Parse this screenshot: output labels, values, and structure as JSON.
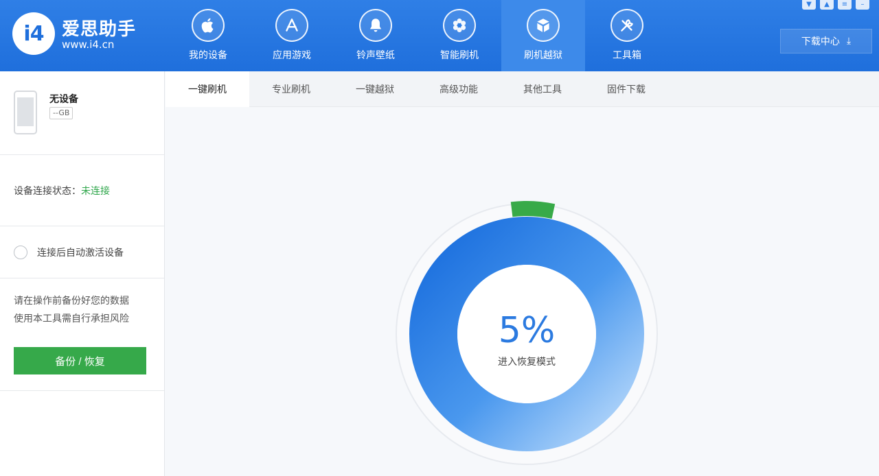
{
  "app": {
    "brand_name": "爱思助手",
    "brand_url": "www.i4.cn",
    "logo_text": "i4"
  },
  "nav": [
    {
      "label": "我的设备",
      "icon": "apple-icon"
    },
    {
      "label": "应用游戏",
      "icon": "app-store-icon"
    },
    {
      "label": "铃声壁纸",
      "icon": "bell-icon"
    },
    {
      "label": "智能刷机",
      "icon": "flower-icon"
    },
    {
      "label": "刷机越狱",
      "icon": "box-icon",
      "active": true
    },
    {
      "label": "工具箱",
      "icon": "tools-icon"
    }
  ],
  "download_center": {
    "label": "下载中心"
  },
  "sidebar": {
    "device_name": "无设备",
    "device_storage": "--GB",
    "connection_label": "设备连接状态：",
    "connection_status": "未连接",
    "auto_activate_label": "连接后自动激活设备",
    "notice_line1": "请在操作前备份好您的数据",
    "notice_line2": "使用本工具需自行承担风险",
    "backup_button": "备份 / 恢复"
  },
  "tabs": [
    {
      "label": "一键刷机",
      "active": true
    },
    {
      "label": "专业刷机"
    },
    {
      "label": "一键越狱"
    },
    {
      "label": "高级功能"
    },
    {
      "label": "其他工具"
    },
    {
      "label": "固件下载"
    }
  ],
  "progress": {
    "percent_text": "5%",
    "percent_value": 5,
    "status_label": "进入恢复模式",
    "colors": {
      "ring_start": "#1d72e0",
      "ring_end": "#a9cff8",
      "indicator": "#38aa48"
    }
  }
}
